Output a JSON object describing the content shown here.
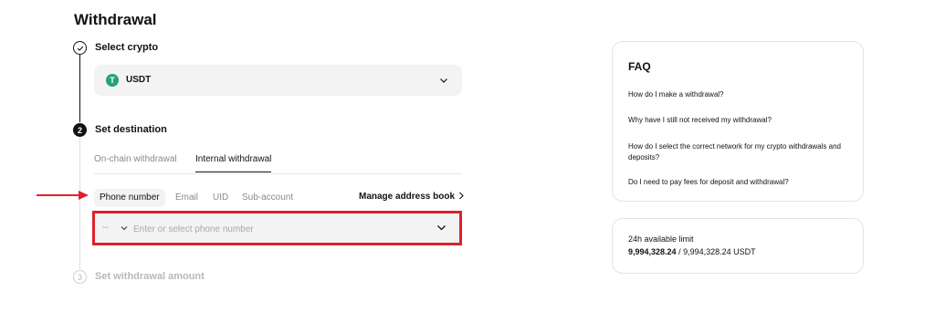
{
  "page": {
    "title": "Withdrawal"
  },
  "steps": [
    {
      "number": "1",
      "label": "Select crypto",
      "state": "done"
    },
    {
      "number": "2",
      "label": "Set destination",
      "state": "active"
    },
    {
      "number": "3",
      "label": "Set withdrawal amount",
      "state": "pending"
    }
  ],
  "crypto_select": {
    "coin": "USDT",
    "coin_icon_glyph": "T",
    "coin_color": "#26a17b",
    "icon": "chevron-down-icon"
  },
  "tabs": [
    {
      "label": "On-chain withdrawal",
      "active": false
    },
    {
      "label": "Internal withdrawal",
      "active": true
    }
  ],
  "methods": [
    {
      "label": "Phone number",
      "active": true
    },
    {
      "label": "Email",
      "active": false
    },
    {
      "label": "UID",
      "active": false
    },
    {
      "label": "Sub-account",
      "active": false
    }
  ],
  "address_book": {
    "label": "Manage address book",
    "icon": "chevron-right-icon"
  },
  "phone_field": {
    "country_code": "--",
    "value": "",
    "placeholder": "Enter or select phone number",
    "highlight_color": "#e0212a"
  },
  "annotation": {
    "arrow_color": "#e0212a",
    "icon": "arrow-right-icon"
  },
  "faq": {
    "title": "FAQ",
    "items": [
      "How do I make a withdrawal?",
      "Why have I still not received my withdrawal?",
      "How do I select the correct network for my crypto withdrawals and deposits?",
      "Do I need to pay fees for deposit and withdrawal?"
    ]
  },
  "limit": {
    "title": "24h available limit",
    "available": "9,994,328.24",
    "separator": " / ",
    "total": "9,994,328.24 USDT"
  }
}
